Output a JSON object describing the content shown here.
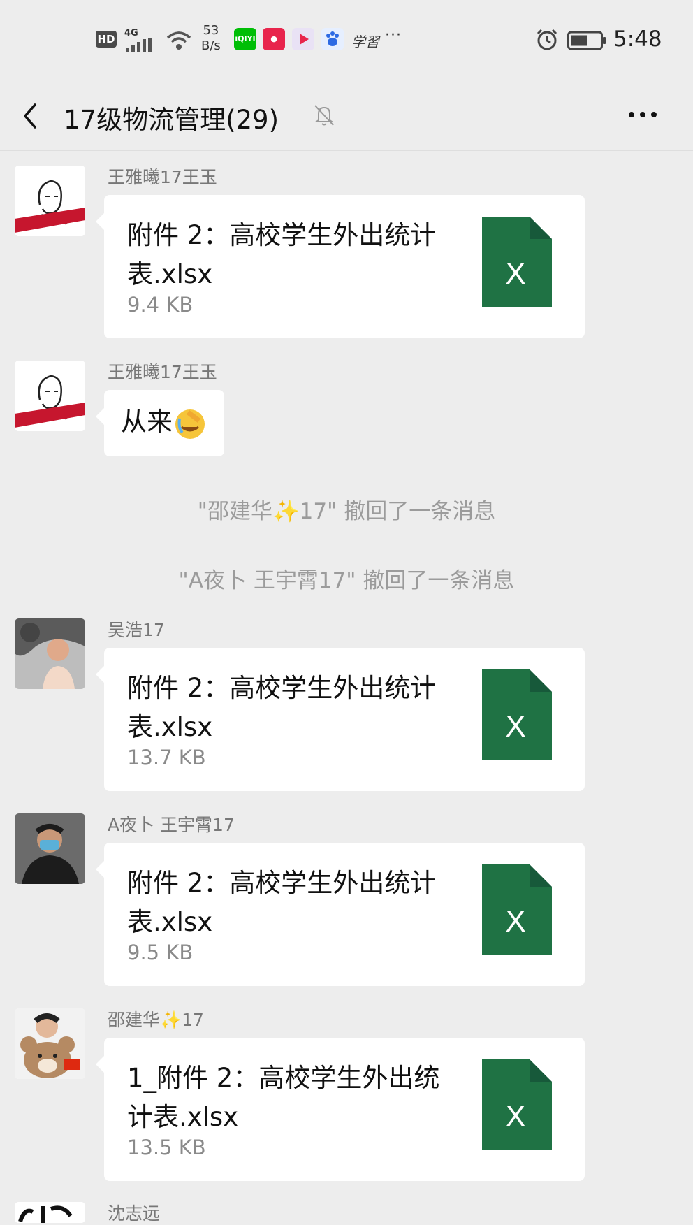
{
  "status_bar": {
    "hd": "HD",
    "network": "4G",
    "speed_value": "53",
    "speed_unit": "B/s",
    "app_icons": [
      "iqiyi-icon",
      "live-icon",
      "video-icon",
      "baidu-icon"
    ],
    "iqiyi_text": "iQIYI",
    "xuexi": "学習",
    "more": "···",
    "time": "5:48"
  },
  "header": {
    "title": "17级物流管理(29)"
  },
  "messages": [
    {
      "sender": "王雅曦17王玉",
      "file_name": "附件 2：高校学生外出统计表.xlsx",
      "file_size": "9.4 KB"
    },
    {
      "sender": "王雅曦17王玉",
      "text": "从来"
    },
    {
      "sender": "吴浩17",
      "file_name": "附件 2：高校学生外出统计表.xlsx",
      "file_size": "13.7 KB"
    },
    {
      "sender": "A夜卜 王宇霄17",
      "file_name": "附件 2：高校学生外出统计表.xlsx",
      "file_size": "9.5 KB"
    },
    {
      "sender": "邵建华✨17",
      "file_name": "1_附件 2：高校学生外出统计表.xlsx",
      "file_size": "13.5 KB"
    },
    {
      "sender": "沈志远"
    }
  ],
  "system_notices": [
    "\"邵建华✨17\" 撤回了一条消息",
    "\"A夜卜 王宇霄17\" 撤回了一条消息"
  ],
  "file_icon_letter": "X",
  "colors": {
    "excel_green": "#1f7244",
    "background": "#ededed",
    "bubble": "#ffffff"
  }
}
